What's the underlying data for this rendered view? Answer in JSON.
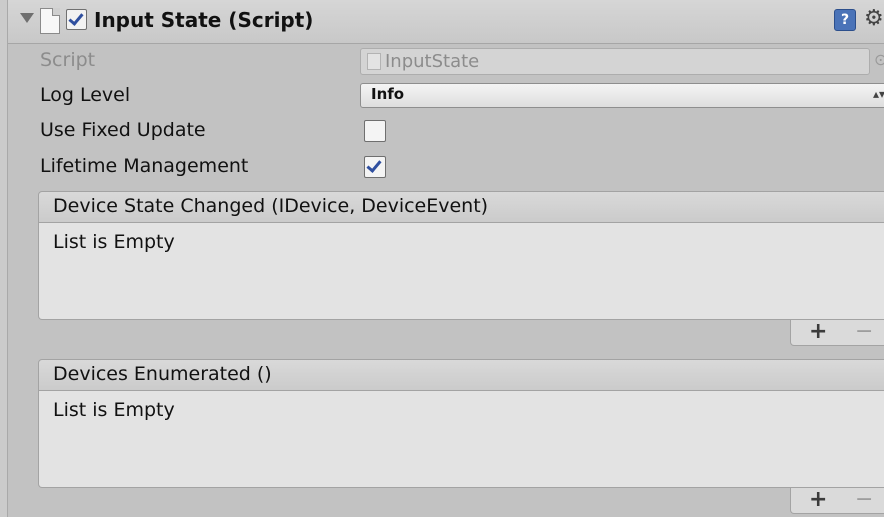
{
  "component": {
    "title": "Input State (Script)",
    "enabled": true
  },
  "fields": {
    "script_label": "Script",
    "script_value": "InputState",
    "log_level_label": "Log Level",
    "log_level_value": "Info",
    "fixed_update_label": "Use Fixed Update",
    "fixed_update_checked": false,
    "lifetime_label": "Lifetime Management",
    "lifetime_checked": true
  },
  "events": [
    {
      "header": "Device State Changed (IDevice, DeviceEvent)",
      "empty_text": "List is Empty"
    },
    {
      "header": "Devices Enumerated ()",
      "empty_text": "List is Empty"
    }
  ],
  "buttons": {
    "add": "+",
    "remove": "−"
  },
  "icons": {
    "foldout": "triangle-down-icon",
    "script": "script-doc-icon",
    "help": "help-book-icon",
    "settings": "gear-icon",
    "picker": "object-picker-icon"
  },
  "colors": {
    "panel_bg": "#c2c2c2",
    "list_bg": "#e3e3e3",
    "check_accent": "#2f4f9f",
    "help_blue": "#4a73b8"
  }
}
